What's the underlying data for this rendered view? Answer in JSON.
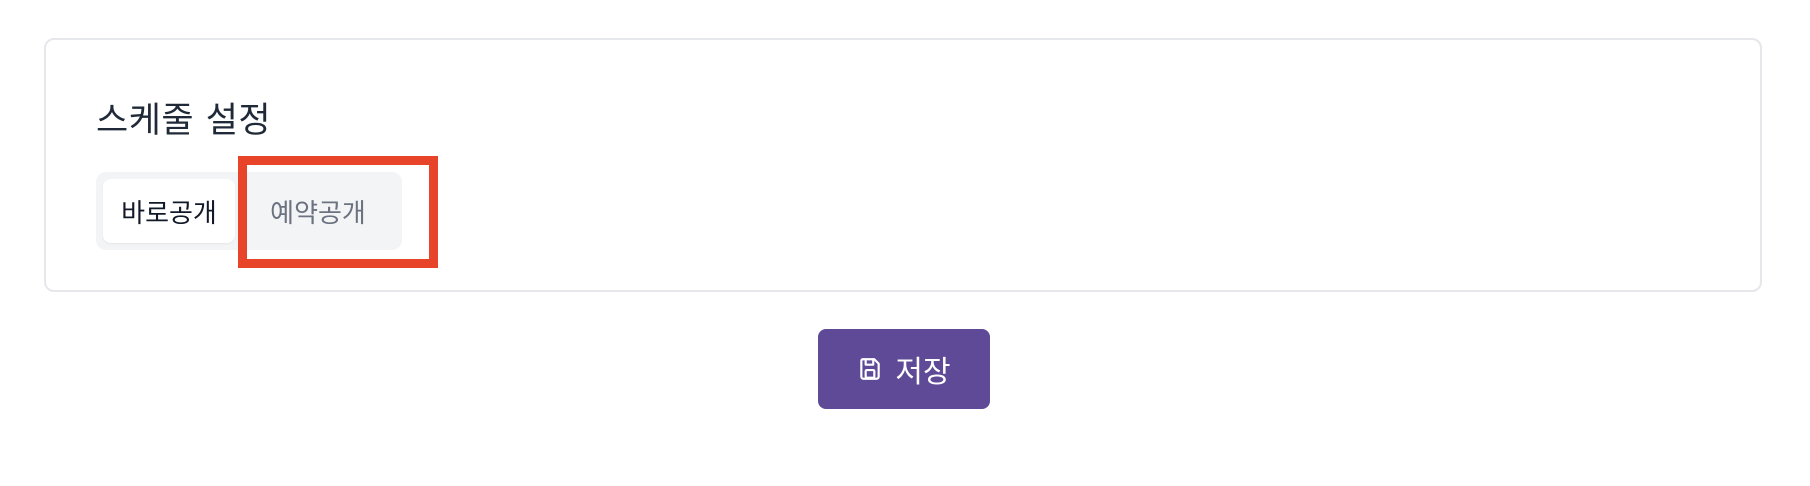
{
  "schedule_section": {
    "title": "스케줄 설정",
    "options": [
      {
        "label": "바로공개",
        "selected": true
      },
      {
        "label": "예약공개",
        "selected": false
      }
    ]
  },
  "annotation": {
    "highlight_color": "#e8442a",
    "highlighted_option": "예약공개"
  },
  "actions": {
    "save_label": "저장",
    "save_icon": "save-icon",
    "save_color": "#5e4a96"
  }
}
